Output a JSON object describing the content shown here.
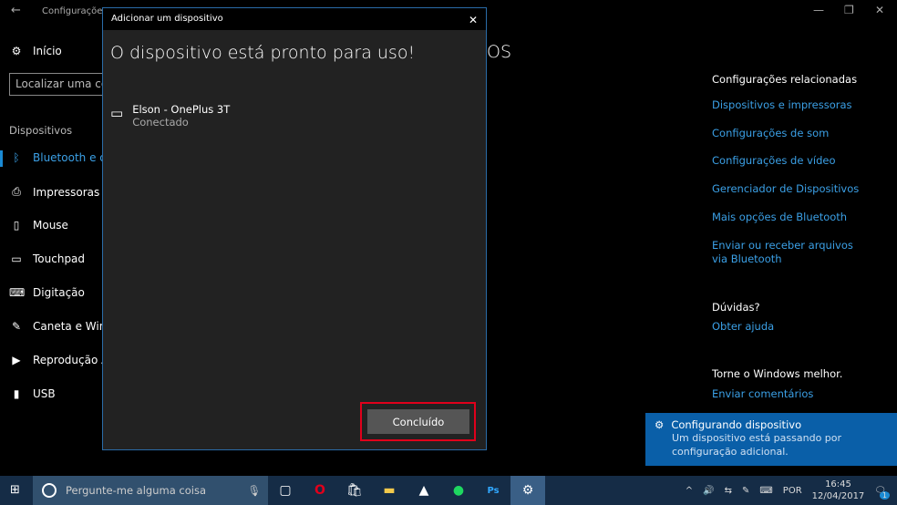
{
  "window": {
    "title": "Configurações"
  },
  "sidebar": {
    "home": "Início",
    "search_placeholder": "Localizar uma con",
    "section": "Dispositivos",
    "items": [
      {
        "label": "Bluetooth e ou",
        "icon": "bluetooth-icon"
      },
      {
        "label": "Impressoras e s",
        "icon": "printer-icon"
      },
      {
        "label": "Mouse",
        "icon": "mouse-icon"
      },
      {
        "label": "Touchpad",
        "icon": "touchpad-icon"
      },
      {
        "label": "Digitação",
        "icon": "keyboard-icon"
      },
      {
        "label": "Caneta e Wind",
        "icon": "pen-icon"
      },
      {
        "label": "Reprodução Au",
        "icon": "autoplay-icon"
      },
      {
        "label": "USB",
        "icon": "usb-icon"
      }
    ]
  },
  "main": {
    "title_fragment": "OS"
  },
  "related": {
    "heading": "Configurações relacionadas",
    "links": [
      "Dispositivos e impressoras",
      "Configurações de som",
      "Configurações de vídeo",
      "Gerenciador de Dispositivos",
      "Mais opções de Bluetooth",
      "Enviar ou receber arquivos via Bluetooth"
    ],
    "help_heading": "Dúvidas?",
    "help_link": "Obter ajuda",
    "feedback_heading": "Torne o Windows melhor.",
    "feedback_link": "Enviar comentários"
  },
  "dialog": {
    "title": "Adicionar um dispositivo",
    "heading": "O dispositivo está pronto para uso!",
    "device_name": "Elson - OnePlus 3T",
    "device_status": "Conectado",
    "done_button": "Concluído"
  },
  "toast": {
    "title": "Configurando dispositivo",
    "body": "Um dispositivo está passando por configuração adicional."
  },
  "taskbar": {
    "search_placeholder": "Pergunte-me alguma coisa",
    "language": "POR",
    "time": "16:45",
    "date": "12/04/2017",
    "notification_count": "1"
  },
  "colors": {
    "accent": "#3ba0e6",
    "toast": "#0a5fa8",
    "highlight": "#e0001b"
  }
}
